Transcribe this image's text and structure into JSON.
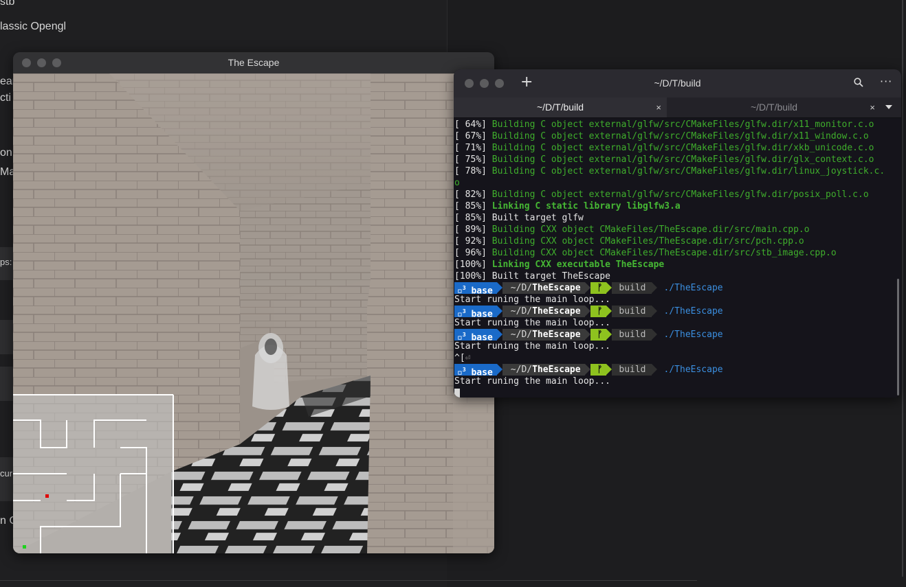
{
  "background_app": {
    "lines": [
      {
        "text": "stb"
      },
      {
        "text": "lassic Opengl"
      },
      {
        "text": "ear"
      },
      {
        "text": "cti"
      },
      {
        "text": "on"
      },
      {
        "text": "Mac"
      },
      {
        "text": "ps:"
      },
      {
        "text": "cur"
      },
      {
        "text": "n C"
      }
    ]
  },
  "game_window": {
    "title": "The Escape"
  },
  "terminal": {
    "title": "~/D/T/build",
    "tabs": [
      {
        "label": "~/D/T/build",
        "close": "×"
      },
      {
        "label": "~/D/T/build",
        "close": "×"
      }
    ],
    "new_tab": "+",
    "more": "···",
    "build_lines": [
      {
        "pct": "[ 64%] ",
        "text": "Building C object external/glfw/src/CMakeFiles/glfw.dir/x11_monitor.c.o",
        "style": "grn"
      },
      {
        "pct": "[ 67%] ",
        "text": "Building C object external/glfw/src/CMakeFiles/glfw.dir/x11_window.c.o",
        "style": "grn"
      },
      {
        "pct": "[ 71%] ",
        "text": "Building C object external/glfw/src/CMakeFiles/glfw.dir/xkb_unicode.c.o",
        "style": "grn"
      },
      {
        "pct": "[ 75%] ",
        "text": "Building C object external/glfw/src/CMakeFiles/glfw.dir/glx_context.c.o",
        "style": "grn"
      },
      {
        "pct": "[ 78%] ",
        "text": "Building C object external/glfw/src/CMakeFiles/glfw.dir/linux_joystick.c.",
        "style": "grn"
      },
      {
        "pct": "",
        "text": "o",
        "style": "grn"
      },
      {
        "pct": "[ 82%] ",
        "text": "Building C object external/glfw/src/CMakeFiles/glfw.dir/posix_poll.c.o",
        "style": "grn"
      },
      {
        "pct": "[ 85%] ",
        "text": "Linking C static library libglfw3.a",
        "style": "bgrn"
      },
      {
        "pct": "[ 85%] ",
        "text": "Built target glfw",
        "style": "pct"
      },
      {
        "pct": "[ 89%] ",
        "text": "Building CXX object CMakeFiles/TheEscape.dir/src/main.cpp.o",
        "style": "grn"
      },
      {
        "pct": "[ 92%] ",
        "text": "Building CXX object CMakeFiles/TheEscape.dir/src/pch.cpp.o",
        "style": "grn"
      },
      {
        "pct": "[ 96%] ",
        "text": "Building CXX object CMakeFiles/TheEscape.dir/src/stb_image.cpp.o",
        "style": "grn"
      },
      {
        "pct": "[100%] ",
        "text": "Linking CXX executable TheEscape",
        "style": "bgrn"
      },
      {
        "pct": "[100%] ",
        "text": "Built target TheEscape",
        "style": "pct"
      }
    ],
    "prompt": {
      "env": "base",
      "env_sup": "3",
      "path_prefix": "~/D/",
      "path_bold": "TheEscape",
      "git": "ᚠ",
      "dir": "build",
      "command": "./TheEscape"
    },
    "run_output": "Start runing the main loop...",
    "interrupt": "^[",
    "colors": {
      "env_bg": "#1a6ac8",
      "git_bg": "#8ec21f",
      "green_text": "#3fae2c",
      "command": "#3b8fe0"
    }
  }
}
